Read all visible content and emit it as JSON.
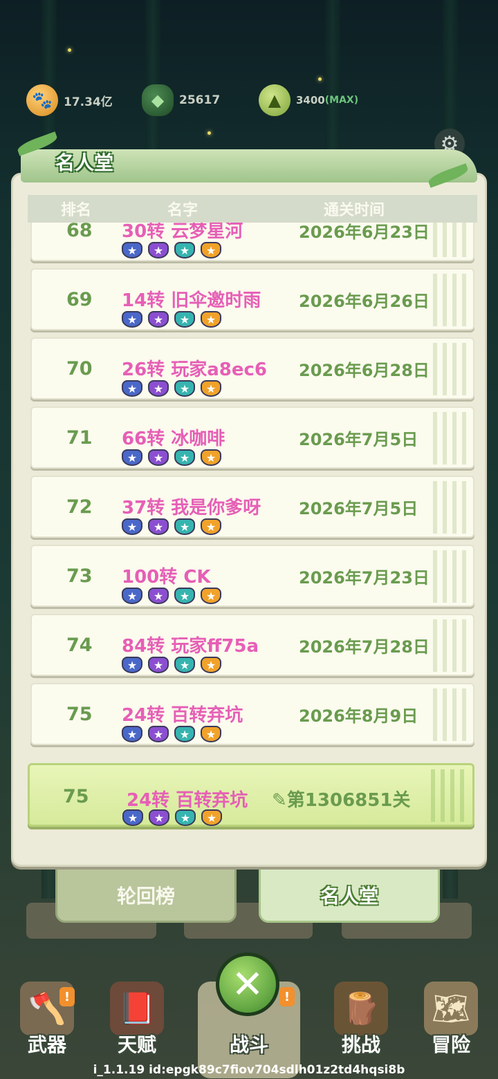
{
  "resources": {
    "coin": "17.34亿",
    "gem": "25617",
    "sprout": "3400",
    "sprout_max": "(MAX)"
  },
  "icons": {
    "coin": "paw-coin-icon",
    "gem": "green-egg-icon",
    "sprout": "bamboo-shoot-icon",
    "settings": "gear-icon",
    "close": "close-icon"
  },
  "panel": {
    "title": "名人堂",
    "columns": {
      "rank": "排名",
      "name": "名字",
      "time": "通关时间"
    },
    "rows": [
      {
        "rank": "68",
        "name": "30转 云梦星河",
        "date": "2026年6月23日"
      },
      {
        "rank": "69",
        "name": "14转 旧伞邀时雨",
        "date": "2026年6月26日"
      },
      {
        "rank": "70",
        "name": "26转 玩家a8ec6",
        "date": "2026年6月28日"
      },
      {
        "rank": "71",
        "name": "66转 冰咖啡",
        "date": "2026年7月5日"
      },
      {
        "rank": "72",
        "name": "37转 我是你爹呀",
        "date": "2026年7月5日"
      },
      {
        "rank": "73",
        "name": "100转 CK",
        "date": "2026年7月23日"
      },
      {
        "rank": "74",
        "name": "84转 玩家ff75a",
        "date": "2026年7月28日"
      },
      {
        "rank": "75",
        "name": "24转 百转弃坑",
        "date": "2026年8月9日"
      }
    ],
    "mine": {
      "rank": "75",
      "name": "24转 百转弃坑",
      "progress": "第1306851关"
    }
  },
  "tabs": {
    "rebirth": "轮回榜",
    "hall": "名人堂"
  },
  "nav": {
    "weapon": "武器",
    "talent": "天赋",
    "battle": "战斗",
    "challenge": "挑战",
    "adventure": "冒险",
    "alert": "!"
  },
  "version": "i_1.1.19 id:epgk89c7fiov704sdlh01z2td4hqsi8b",
  "colors": {
    "name_pink": "#e65fb6",
    "rank_green": "#6a9b4f",
    "mine_row": "#e8f5b8",
    "panel_bg": "#ecebd9"
  }
}
